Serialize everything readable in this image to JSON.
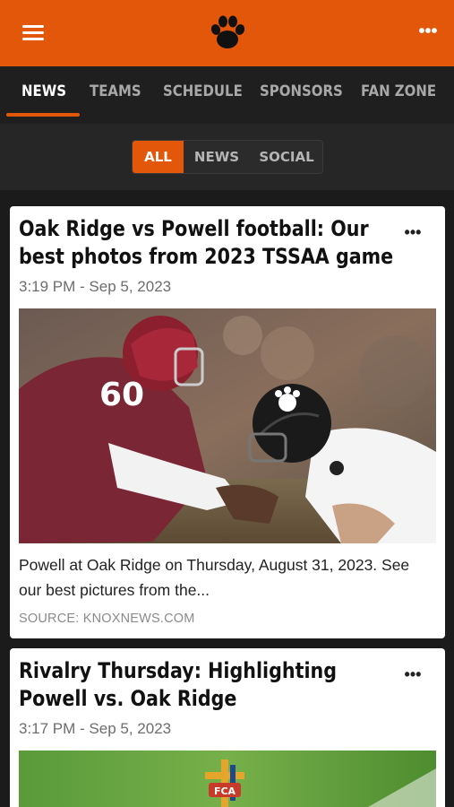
{
  "header": {
    "menu_icon": "hamburger-icon",
    "logo_icon": "paw-logo-icon",
    "more_icon": "more-dots-icon",
    "more_glyph": "•••",
    "brand_color": "#e3570b"
  },
  "tabs": [
    {
      "label": "NEWS",
      "active": true
    },
    {
      "label": "TEAMS",
      "active": false
    },
    {
      "label": "SCHEDULE",
      "active": false
    },
    {
      "label": "SPONSORS",
      "active": false
    },
    {
      "label": "FAN ZONE",
      "active": false
    }
  ],
  "filter": {
    "options": [
      {
        "label": "ALL",
        "active": true
      },
      {
        "label": "NEWS",
        "active": false
      },
      {
        "label": "SOCIAL",
        "active": false
      }
    ]
  },
  "articles": [
    {
      "title": "Oak Ridge vs Powell football: Our best photos from 2023 TSSAA game",
      "time": "3:19 PM - Sep 5, 2023",
      "description": "Powell at Oak Ridge on Thursday, August 31, 2023. See our best pictures from the...",
      "source": "SOURCE: KNOXNEWS.COM",
      "more_glyph": "•••",
      "image_desc_icon": "football-photo"
    },
    {
      "title": "Rivalry Thursday: Highlighting Powell vs. Oak Ridge",
      "time": "3:17 PM - Sep 5, 2023",
      "more_glyph": "•••",
      "image_desc_icon": "fca-logo-photo"
    }
  ]
}
